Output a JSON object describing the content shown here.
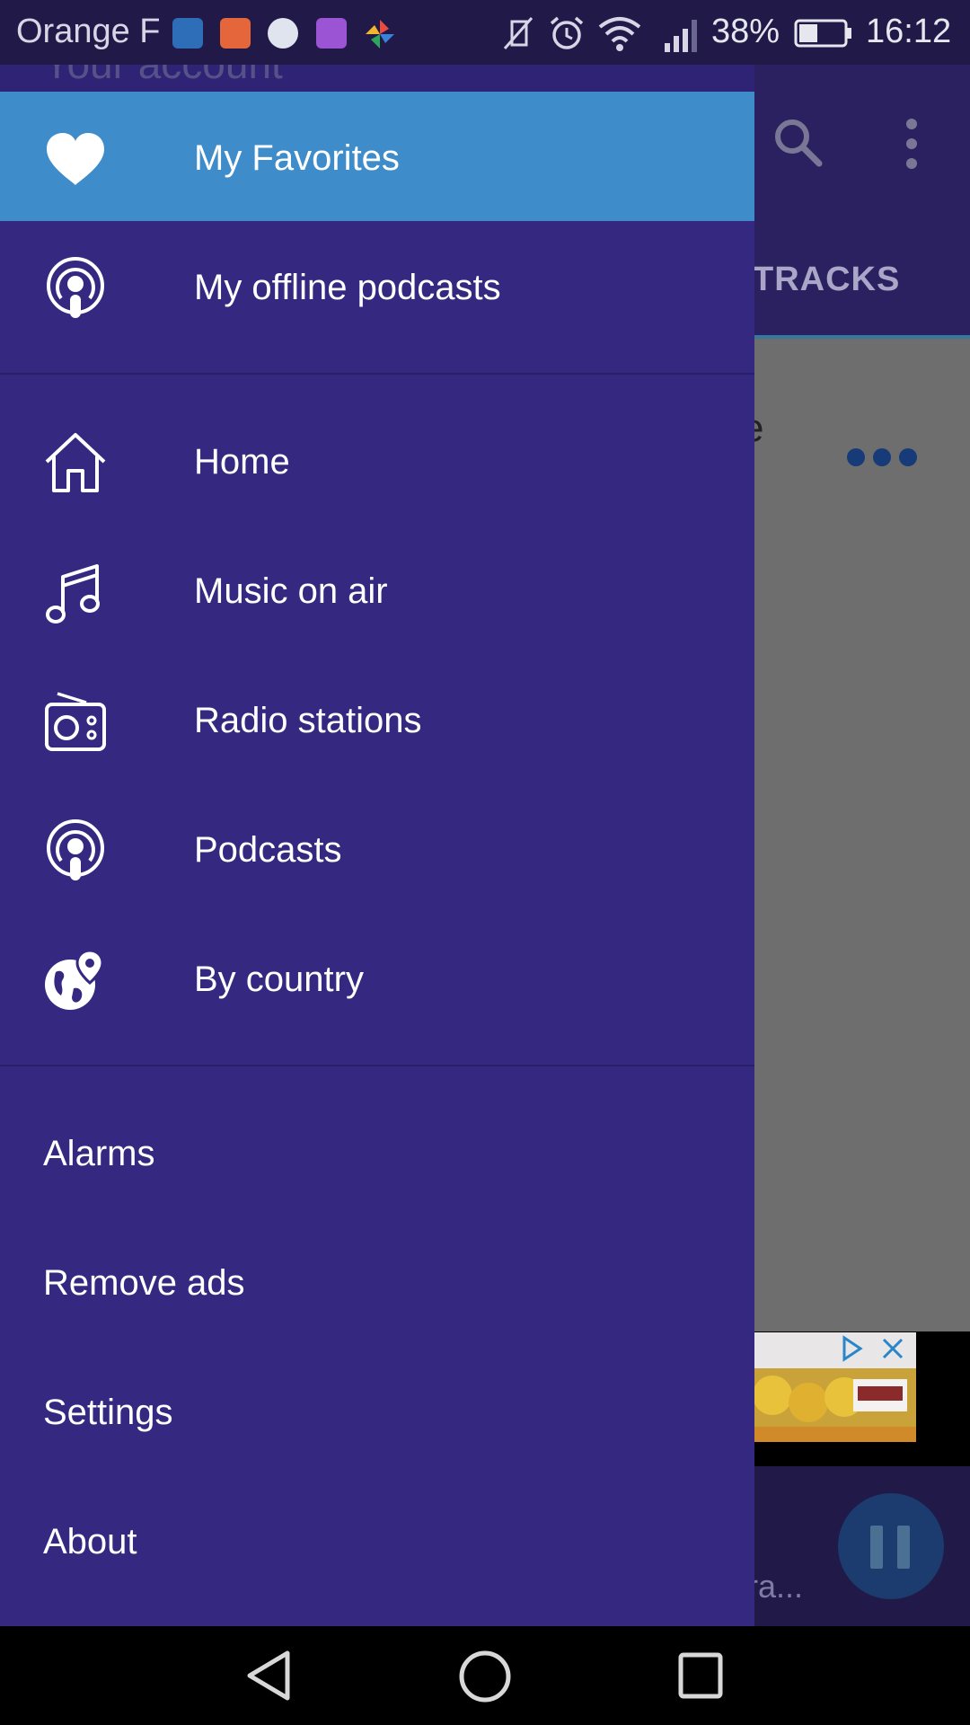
{
  "status_bar": {
    "carrier": "Orange F",
    "battery_percent": "38%",
    "time": "16:12"
  },
  "drawer_header": {
    "account_text": "Your account"
  },
  "background_app": {
    "tab_label": "TRACKS",
    "partial_text": "e",
    "player_partial_text": "ra..."
  },
  "drawer": {
    "primary_items": [
      {
        "label": "My Favorites",
        "icon": "heart-icon",
        "selected": true
      },
      {
        "label": "My offline podcasts",
        "icon": "podcast-icon",
        "selected": false
      }
    ],
    "browse_items": [
      {
        "label": "Home",
        "icon": "home-icon"
      },
      {
        "label": "Music on air",
        "icon": "music-note-icon"
      },
      {
        "label": "Radio stations",
        "icon": "radio-icon"
      },
      {
        "label": "Podcasts",
        "icon": "podcast-icon"
      },
      {
        "label": "By country",
        "icon": "globe-pin-icon"
      }
    ],
    "other_items": [
      {
        "label": "Alarms"
      },
      {
        "label": "Remove ads"
      },
      {
        "label": "Settings"
      },
      {
        "label": "About"
      }
    ]
  },
  "colors": {
    "drawer_bg": "#352880",
    "selected_bg": "#3e8cc9",
    "status_bar_bg": "#211a48"
  }
}
